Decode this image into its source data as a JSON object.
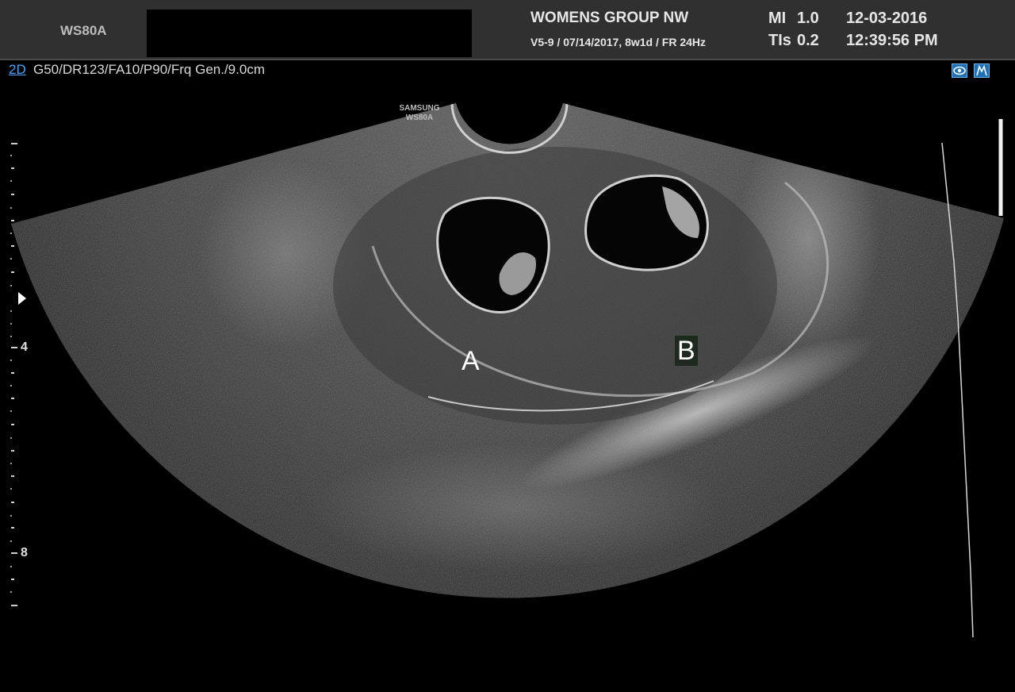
{
  "header": {
    "device_name": "WS80A",
    "site_name": "WOMENS GROUP NW",
    "probe_info": "V5-9 / 07/14/2017, 8w1d / FR 24Hz",
    "mi_label": "MI",
    "mi_value": "1.0",
    "tis_label": "TIs",
    "tis_value": "0.2",
    "date": "12-03-2016",
    "time": "12:39:56 PM"
  },
  "params": {
    "mode": "2D",
    "settings": "G50/DR123/FA10/P90/Frq Gen./9.0cm"
  },
  "toolbar": {
    "icons": [
      "eye-view-icon",
      "dual-view-icon"
    ]
  },
  "image": {
    "brand_line1": "SAMSUNG",
    "brand_line2": "WS80A",
    "marker_a": "A",
    "marker_b": "B"
  },
  "depth_scale": {
    "labels": [
      "4",
      "8"
    ]
  },
  "colors": {
    "header_bg": "#303030",
    "accent_blue": "#4aa3ff",
    "icon_blue": "#1f6fb5"
  }
}
